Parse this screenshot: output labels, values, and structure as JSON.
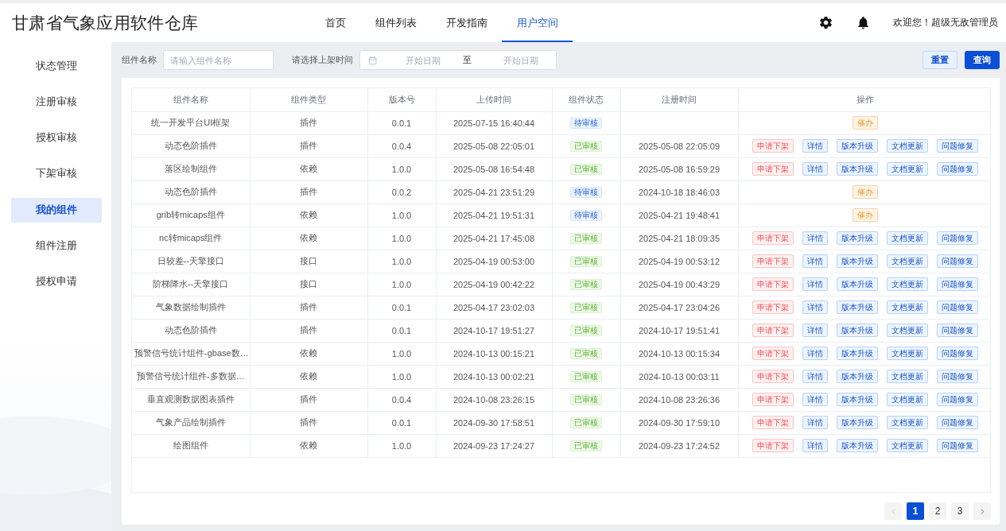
{
  "header": {
    "title": "甘肃省气象应用软件仓库",
    "nav": [
      {
        "label": "首页",
        "selected": false
      },
      {
        "label": "组件列表",
        "selected": false
      },
      {
        "label": "开发指南",
        "selected": false
      },
      {
        "label": "用户空间",
        "selected": true
      }
    ],
    "welcome": "欢迎您！超级无敌管理员"
  },
  "sidebar": {
    "items": [
      {
        "label": "状态管理",
        "selected": false
      },
      {
        "label": "注册审核",
        "selected": false
      },
      {
        "label": "授权审核",
        "selected": false
      },
      {
        "label": "下架审核",
        "selected": false
      },
      {
        "label": "我的组件",
        "selected": true
      },
      {
        "label": "组件注册",
        "selected": false
      },
      {
        "label": "授权申请",
        "selected": false
      }
    ]
  },
  "filters": {
    "name_label": "组件名称",
    "name_field": {
      "placeholder": "请输入组件名称"
    },
    "date_label": "请选择上架时间",
    "date_range": {
      "start_placeholder": "开始日期",
      "separator": "至",
      "end_placeholder": "开始日期"
    },
    "buttons": [
      {
        "label": "重置",
        "kind": "secondary"
      },
      {
        "label": "查询",
        "kind": "primary"
      }
    ]
  },
  "table": {
    "columns": [
      "组件名称",
      "组件类型",
      "版本号",
      "上传时间",
      "组件状态",
      "注册时间",
      "操作"
    ],
    "rows": [
      {
        "name": "统一开发平台UI框架",
        "type": "插件",
        "version": "0.0.1",
        "upload_time": "2025-07-15 16:40:44",
        "status": {
          "label": "待审核",
          "kind": "pending"
        },
        "actions": [
          {
            "label": "催办",
            "kind": "warning"
          }
        ]
      },
      {
        "name": "动态色阶插件",
        "type": "插件",
        "version": "0.0.4",
        "upload_time": "2025-05-08 22:05:01",
        "status": {
          "label": "已审核",
          "kind": "approved"
        },
        "register_time": "2025-05-08 22:05:09",
        "actions": [
          {
            "label": "申请下架",
            "kind": "danger"
          },
          {
            "label": "详情",
            "kind": "primary"
          },
          {
            "label": "版本升级",
            "kind": "primary"
          },
          {
            "label": "文档更新",
            "kind": "primary"
          },
          {
            "label": "问题修复",
            "kind": "primary"
          }
        ]
      },
      {
        "name": "落区绘制组件",
        "type": "依赖",
        "version": "1.0.0",
        "upload_time": "2025-05-08 16:54:48",
        "status": {
          "label": "已审核",
          "kind": "approved"
        },
        "register_time": "2025-05-08 16:59:29",
        "actions": [
          {
            "label": "申请下架",
            "kind": "danger"
          },
          {
            "label": "详情",
            "kind": "primary"
          },
          {
            "label": "版本升级",
            "kind": "primary"
          },
          {
            "label": "文档更新",
            "kind": "primary"
          },
          {
            "label": "问题修复",
            "kind": "primary"
          }
        ]
      },
      {
        "name": "动态色阶插件",
        "type": "插件",
        "version": "0.0.2",
        "upload_time": "2025-04-21 23:51:29",
        "status": {
          "label": "待审核",
          "kind": "pending"
        },
        "register_time": "2024-10-18 18:46:03",
        "actions": [
          {
            "label": "催办",
            "kind": "warning"
          }
        ]
      },
      {
        "name": "grib转micaps组件",
        "type": "依赖",
        "version": "1.0.0",
        "upload_time": "2025-04-21 19:51:31",
        "status": {
          "label": "待审核",
          "kind": "pending"
        },
        "register_time": "2025-04-21 19:48:41",
        "actions": [
          {
            "label": "催办",
            "kind": "warning"
          }
        ]
      },
      {
        "name": "nc转micaps组件",
        "type": "依赖",
        "version": "1.0.0",
        "upload_time": "2025-04-21 17:45:08",
        "status": {
          "label": "已审核",
          "kind": "approved"
        },
        "register_time": "2025-04-21 18:09:35",
        "actions": [
          {
            "label": "申请下架",
            "kind": "danger"
          },
          {
            "label": "详情",
            "kind": "primary"
          },
          {
            "label": "版本升级",
            "kind": "primary"
          },
          {
            "label": "文档更新",
            "kind": "primary"
          },
          {
            "label": "问题修复",
            "kind": "primary"
          }
        ]
      },
      {
        "name": "日较差--天擎接口",
        "type": "接口",
        "version": "1.0.0",
        "upload_time": "2025-04-19 00:53:00",
        "status": {
          "label": "已审核",
          "kind": "approved"
        },
        "register_time": "2025-04-19 00:53:12",
        "actions": [
          {
            "label": "申请下架",
            "kind": "danger"
          },
          {
            "label": "详情",
            "kind": "primary"
          },
          {
            "label": "版本升级",
            "kind": "primary"
          },
          {
            "label": "文档更新",
            "kind": "primary"
          },
          {
            "label": "问题修复",
            "kind": "primary"
          }
        ]
      },
      {
        "name": "阶梯降水--天擎接口",
        "type": "接口",
        "version": "1.0.0",
        "upload_time": "2025-04-19 00:42:22",
        "status": {
          "label": "已审核",
          "kind": "approved"
        },
        "register_time": "2025-04-19 00:43:29",
        "actions": [
          {
            "label": "申请下架",
            "kind": "danger"
          },
          {
            "label": "详情",
            "kind": "primary"
          },
          {
            "label": "版本升级",
            "kind": "primary"
          },
          {
            "label": "文档更新",
            "kind": "primary"
          },
          {
            "label": "问题修复",
            "kind": "primary"
          }
        ]
      },
      {
        "name": "气象数据绘制插件",
        "type": "插件",
        "version": "0.0.1",
        "upload_time": "2025-04-17 23:02:03",
        "status": {
          "label": "已审核",
          "kind": "approved"
        },
        "register_time": "2025-04-17 23:04:26",
        "actions": [
          {
            "label": "申请下架",
            "kind": "danger"
          },
          {
            "label": "详情",
            "kind": "primary"
          },
          {
            "label": "版本升级",
            "kind": "primary"
          },
          {
            "label": "文档更新",
            "kind": "primary"
          },
          {
            "label": "问题修复",
            "kind": "primary"
          }
        ]
      },
      {
        "name": "动态色阶插件",
        "type": "插件",
        "version": "0.0.1",
        "upload_time": "2024-10-17 19:51:27",
        "status": {
          "label": "已审核",
          "kind": "approved"
        },
        "register_time": "2024-10-17 19:51:41",
        "actions": [
          {
            "label": "申请下架",
            "kind": "danger"
          },
          {
            "label": "详情",
            "kind": "primary"
          },
          {
            "label": "版本升级",
            "kind": "primary"
          },
          {
            "label": "文档更新",
            "kind": "primary"
          },
          {
            "label": "问题修复",
            "kind": "primary"
          }
        ]
      },
      {
        "name": "预警信号统计组件-gbase数…",
        "type": "依赖",
        "version": "1.0.0",
        "upload_time": "2024-10-13 00:15:21",
        "status": {
          "label": "已审核",
          "kind": "approved"
        },
        "register_time": "2024-10-13 00:15:34",
        "actions": [
          {
            "label": "申请下架",
            "kind": "danger"
          },
          {
            "label": "详情",
            "kind": "primary"
          },
          {
            "label": "版本升级",
            "kind": "primary"
          },
          {
            "label": "文档更新",
            "kind": "primary"
          },
          {
            "label": "问题修复",
            "kind": "primary"
          }
        ]
      },
      {
        "name": "预警信号统计组件-多数据…",
        "type": "依赖",
        "version": "1.0.0",
        "upload_time": "2024-10-13 00:02:21",
        "status": {
          "label": "已审核",
          "kind": "approved"
        },
        "register_time": "2024-10-13 00:03:11",
        "actions": [
          {
            "label": "申请下架",
            "kind": "danger"
          },
          {
            "label": "详情",
            "kind": "primary"
          },
          {
            "label": "版本升级",
            "kind": "primary"
          },
          {
            "label": "文档更新",
            "kind": "primary"
          },
          {
            "label": "问题修复",
            "kind": "primary"
          }
        ]
      },
      {
        "name": "垂直观测数据图表插件",
        "type": "插件",
        "version": "0.0.4",
        "upload_time": "2024-10-08 23:26:15",
        "status": {
          "label": "已审核",
          "kind": "approved"
        },
        "register_time": "2024-10-08 23:26:36",
        "actions": [
          {
            "label": "申请下架",
            "kind": "danger"
          },
          {
            "label": "详情",
            "kind": "primary"
          },
          {
            "label": "版本升级",
            "kind": "primary"
          },
          {
            "label": "文档更新",
            "kind": "primary"
          },
          {
            "label": "问题修复",
            "kind": "primary"
          }
        ]
      },
      {
        "name": "气象产品绘制插件",
        "type": "插件",
        "version": "0.0.1",
        "upload_time": "2024-09-30 17:58:51",
        "status": {
          "label": "已审核",
          "kind": "approved"
        },
        "register_time": "2024-09-30 17:59:10",
        "actions": [
          {
            "label": "申请下架",
            "kind": "danger"
          },
          {
            "label": "详情",
            "kind": "primary"
          },
          {
            "label": "版本升级",
            "kind": "primary"
          },
          {
            "label": "文档更新",
            "kind": "primary"
          },
          {
            "label": "问题修复",
            "kind": "primary"
          }
        ]
      },
      {
        "name": "绘图组件",
        "type": "依赖",
        "version": "1.0.0",
        "upload_time": "2024-09-23 17:24:27",
        "status": {
          "label": "已审核",
          "kind": "approved"
        },
        "register_time": "2024-09-23 17:24:52",
        "actions": [
          {
            "label": "申请下架",
            "kind": "danger"
          },
          {
            "label": "详情",
            "kind": "primary"
          },
          {
            "label": "版本升级",
            "kind": "primary"
          },
          {
            "label": "文档更新",
            "kind": "primary"
          },
          {
            "label": "问题修复",
            "kind": "primary"
          }
        ]
      }
    ]
  },
  "pagination": {
    "prev": {
      "disabled": true
    },
    "pages": [
      {
        "label": "1",
        "selected": true
      },
      {
        "label": "2",
        "selected": false
      },
      {
        "label": "3",
        "selected": false
      }
    ],
    "next": {
      "disabled": false
    }
  }
}
